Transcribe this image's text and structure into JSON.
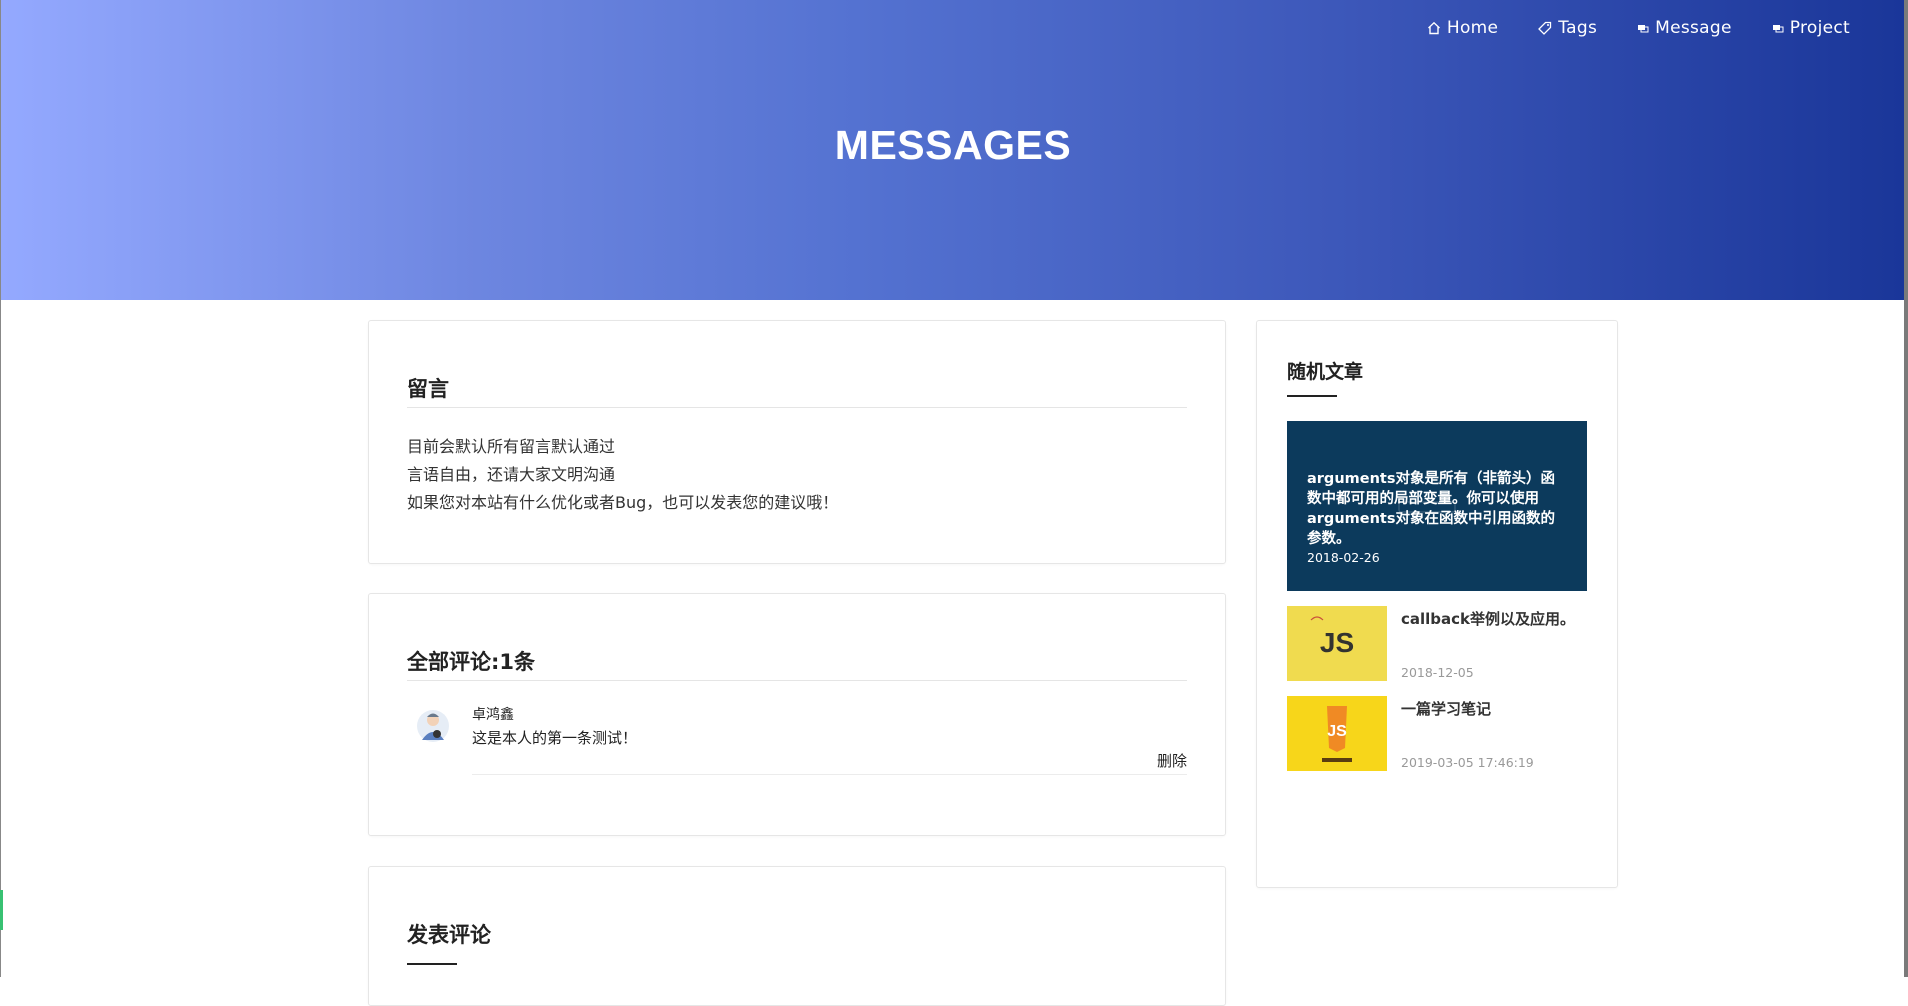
{
  "nav": {
    "items": [
      {
        "label": "Home",
        "icon": "home-icon"
      },
      {
        "label": "Tags",
        "icon": "tag-icon"
      },
      {
        "label": "Message",
        "icon": "message-icon"
      },
      {
        "label": "Project",
        "icon": "project-icon"
      }
    ]
  },
  "hero": {
    "title": "MESSAGES"
  },
  "notice": {
    "title": "留言",
    "lines": [
      "目前会默认所有留言默认通过",
      "言语自由，还请大家文明沟通",
      "如果您对本站有什么优化或者Bug，也可以发表您的建议哦！"
    ]
  },
  "comments": {
    "title": "全部评论:1条",
    "items": [
      {
        "author": "卓鸿鑫",
        "text": "这是本人的第一条测试！",
        "delete_label": "删除",
        "avatar_icon": "user-avatar"
      }
    ]
  },
  "compose": {
    "title": "发表评论"
  },
  "sidebar": {
    "title": "随机文章",
    "featured": {
      "text": "arguments对象是所有（非箭头）函数中都可用的局部变量。你可以使用arguments对象在函数中引用函数的参数。",
      "date": "2018-02-26",
      "background": "#0c3a5c"
    },
    "posts": [
      {
        "title": "callback举例以及应用。",
        "date": "2018-12-05",
        "thumb_label": "JS",
        "thumb_color": "#f0db4f"
      },
      {
        "title": "一篇学习笔记",
        "date": "2019-03-05 17:46:19",
        "thumb_label": "JS",
        "thumb_color": "#f7d61a"
      }
    ]
  },
  "colors": {
    "hero_gradient_start": "#94a9ff",
    "hero_gradient_end": "#1a3699",
    "card_border": "#e6e6e6"
  }
}
